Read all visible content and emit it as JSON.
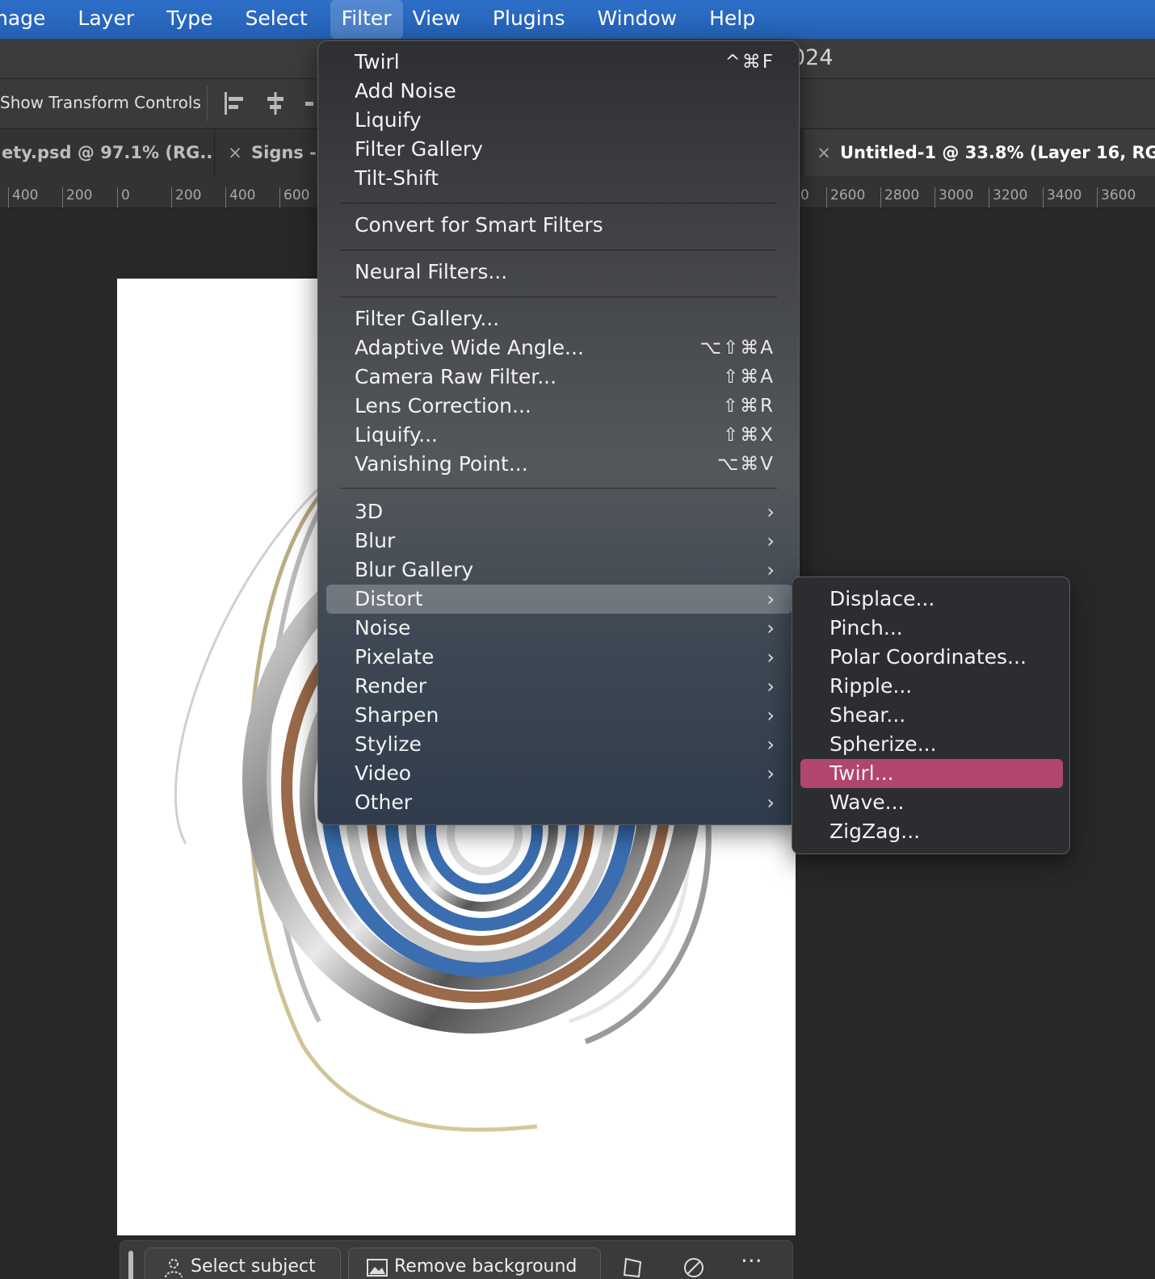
{
  "menubar": {
    "items": [
      "nage",
      "Layer",
      "Type",
      "Select",
      "Filter",
      "View",
      "Plugins",
      "Window",
      "Help"
    ],
    "active": "Filter"
  },
  "title_fragment": "024",
  "options": {
    "show_transform_controls": "Show Transform Controls"
  },
  "tabs": [
    {
      "label": "ety.psd @ 97.1% (RG..."
    },
    {
      "label": "Signs -"
    },
    {
      "label": "Untitled-1 @ 33.8% (Layer 16, RG"
    }
  ],
  "ruler": {
    "left_ticks": [
      "400",
      "200",
      "0",
      "200",
      "400",
      "600"
    ],
    "right_ticks": [
      "0",
      "2600",
      "2800",
      "3000",
      "3200",
      "3400",
      "3600"
    ]
  },
  "filter_menu": {
    "group1": [
      {
        "label": "Twirl",
        "shortcut": "^⌘F"
      },
      {
        "label": "Add Noise",
        "shortcut": ""
      },
      {
        "label": "Liquify",
        "shortcut": ""
      },
      {
        "label": "Filter Gallery",
        "shortcut": ""
      },
      {
        "label": "Tilt-Shift",
        "shortcut": ""
      }
    ],
    "group2": [
      {
        "label": "Convert for Smart Filters"
      }
    ],
    "group3": [
      {
        "label": "Neural Filters..."
      }
    ],
    "group4": [
      {
        "label": "Filter Gallery...",
        "shortcut": ""
      },
      {
        "label": "Adaptive Wide Angle...",
        "shortcut": "⌥⇧⌘A"
      },
      {
        "label": "Camera Raw Filter...",
        "shortcut": "⇧⌘A"
      },
      {
        "label": "Lens Correction...",
        "shortcut": "⇧⌘R"
      },
      {
        "label": "Liquify...",
        "shortcut": "⇧⌘X"
      },
      {
        "label": "Vanishing Point...",
        "shortcut": "⌥⌘V"
      }
    ],
    "group5": [
      "3D",
      "Blur",
      "Blur Gallery",
      "Distort",
      "Noise",
      "Pixelate",
      "Render",
      "Sharpen",
      "Stylize",
      "Video",
      "Other"
    ],
    "highlighted": "Distort",
    "submenu_arrow": "›"
  },
  "distort_submenu": {
    "items": [
      "Displace...",
      "Pinch...",
      "Polar Coordinates...",
      "Ripple...",
      "Shear...",
      "Spherize...",
      "Twirl...",
      "Wave...",
      "ZigZag..."
    ],
    "highlighted": "Twirl...",
    "highlight_color": "#b0466f"
  },
  "taskbar": {
    "select_subject": "Select subject",
    "remove_background": "Remove background",
    "more": "···"
  },
  "colors": {
    "menubar": "#2d6fc8",
    "swirl_blue": "#3a6eb0",
    "swirl_copper": "#9a6a4a"
  }
}
